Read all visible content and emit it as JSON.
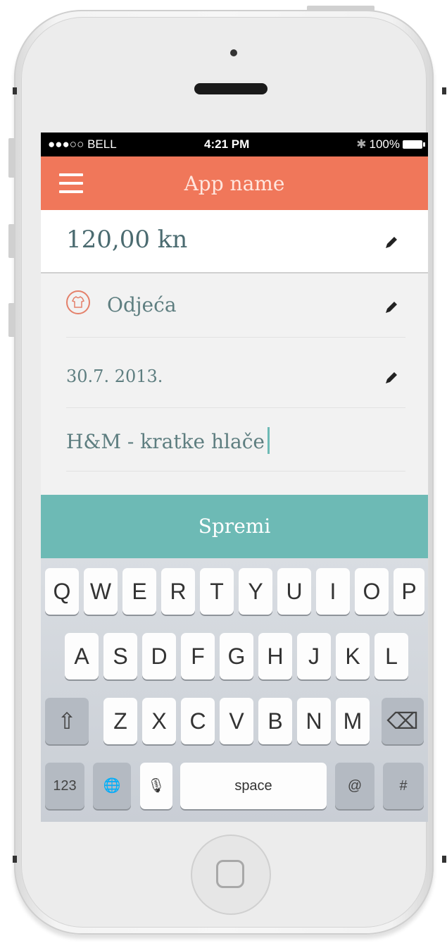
{
  "status_bar": {
    "carrier": "●●●○○ BELL",
    "time": "4:21 PM",
    "battery": "100%"
  },
  "header": {
    "title": "App name"
  },
  "form": {
    "amount": "120,00 kn",
    "category": "Odjeća",
    "date": "30.7. 2013.",
    "note": "H&M - kratke hlače"
  },
  "save_button": {
    "label": "Spremi"
  },
  "keyboard": {
    "row1": [
      "Q",
      "W",
      "E",
      "R",
      "T",
      "Y",
      "U",
      "I",
      "O",
      "P"
    ],
    "row2": [
      "A",
      "S",
      "D",
      "F",
      "G",
      "H",
      "J",
      "K",
      "L"
    ],
    "row3": [
      "Z",
      "X",
      "C",
      "V",
      "B",
      "N",
      "M"
    ],
    "shift": "⇧",
    "backspace": "⌫",
    "numbers": "123",
    "globe": "🌐",
    "mic": "🎙",
    "space": "space",
    "at": "@",
    "hash": "#"
  }
}
